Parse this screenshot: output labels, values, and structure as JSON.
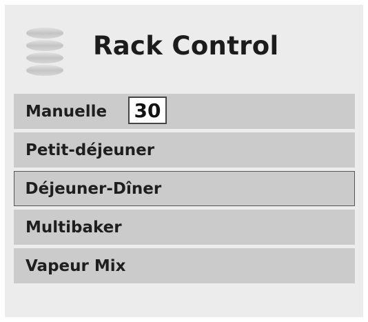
{
  "header": {
    "title": "Rack Control",
    "icon": "rack-icon"
  },
  "menu": {
    "items": [
      {
        "label": "Manuelle",
        "value": "30"
      },
      {
        "label": "Petit-déjeuner"
      },
      {
        "label": "Déjeuner-Dîner",
        "selected": true
      },
      {
        "label": "Multibaker"
      },
      {
        "label": "Vapeur Mix"
      }
    ]
  },
  "colors": {
    "panel_background": "#ececec",
    "item_background": "#cbcbcb",
    "selected_border": "#555555",
    "text": "#1e1e1e"
  }
}
